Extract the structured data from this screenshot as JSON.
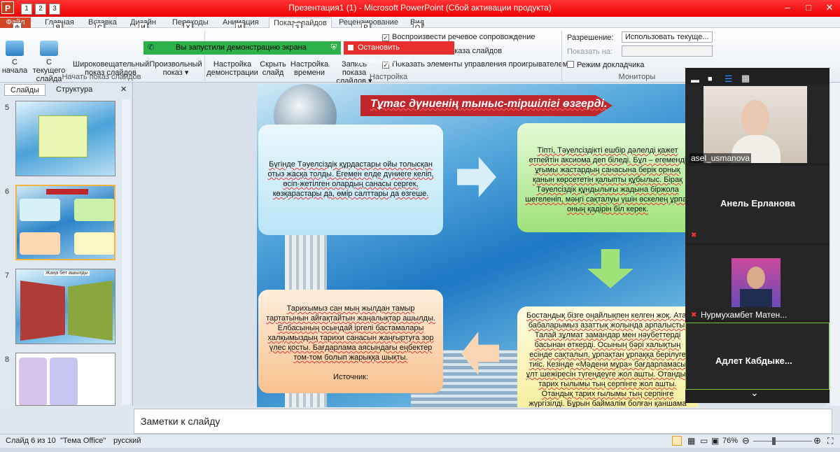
{
  "titlebar": {
    "title": "Презентация1 (1)  -  Microsoft PowerPoint (Сбой активации продукта)",
    "app_letter": "P",
    "qat_keytips": [
      "1",
      "2",
      "3"
    ],
    "minimize_label": "–",
    "restore_label": "□",
    "close_label": "✕"
  },
  "tabs": [
    {
      "label": "Файл",
      "keytip": "Ф"
    },
    {
      "label": "Главная",
      "keytip": "Я"
    },
    {
      "label": "Вставка",
      "keytip": "С"
    },
    {
      "label": "Дизайн",
      "keytip": "И"
    },
    {
      "label": "Переходы",
      "keytip": "Х"
    },
    {
      "label": "Анимация",
      "keytip": "И"
    },
    {
      "label": "Показ слайдов",
      "keytip": "З"
    },
    {
      "label": "Рецензирование",
      "keytip": "Р"
    },
    {
      "label": "Вид",
      "keytip": "О"
    }
  ],
  "ribbon": {
    "btn_from_start": "С\nначала",
    "btn_from_current": "С текущего\nслайда",
    "btn_broadcast": "Широковещательный\nпоказ слайдов",
    "btn_custom": "Произвольный\nпоказ ▾",
    "group_start": "Начать показ слайдов",
    "btn_setup": "Настройка\nдемонстрации",
    "btn_hide": "Скрыть\nслайд",
    "btn_rehearse": "Настройка\nвремени",
    "btn_record": "Запись показа\nслайдов ▾",
    "chk_narration": "Воспроизвести речевое сопровождение",
    "chk_timings": "ия показа слайдов",
    "chk_controls": "Показать элементы управления проигрывателем",
    "group_setup": "Настройка",
    "resolution_label": "Разрешение:",
    "resolution_value": "Использовать текуще...",
    "show_on_label": "Показать на:",
    "show_on_value": "",
    "presenter_view": "Режим докладчика",
    "group_monitors": "Мониторы"
  },
  "demo_bar": {
    "status": "Вы запустили демонстрацию экрана",
    "stop": "Остановить демонстрацию"
  },
  "left_pane": {
    "tab_slides": "Слайды",
    "tab_outline": "Структура",
    "close": "✕",
    "slides": [
      {
        "num": "5",
        "selected": false
      },
      {
        "num": "6",
        "selected": true
      },
      {
        "num": "7",
        "selected": false,
        "title": "Жаңа бет ашылды"
      },
      {
        "num": "8",
        "selected": false
      }
    ]
  },
  "slide": {
    "title": "Тұтас дүниенің тыныс-тіршілігі өзгерді.",
    "box1": "Бүгінде Тәуелсіздік құрдастары ойы толысқан отыз жасқа толды. Егемен елде дүниеге келіп, өсіп-жетілген олардың санасы сергек, көзқарастары да, өмір салттары да өзгеше.",
    "box2": "Тіпті, Тәуелсіздікті ешбір дәлелді қажет етпейтін аксиома деп біледі. Бұл – егеменді ұғымы жастардың санасына берік орнық қанын көрсететін қалыпты құбылыс. Бірақ Тәуелсіздік құндылығы жадына біржола шегеленіп, мәңгі сақталуы үшін өскелең ұрпақ оның қадірін біл керек.",
    "box3": "Тарихымыз сан мың жылдан тамыр тартатынын айғақтайтын жаңалықтар ашылды. Елбасының осындай іргелі бастамалары халқымыздың тарихи санасын жаңғыртуға зор үлес қосты. Бағдарлама аясындағы еңбектер том-том болып жарыққа шықты.",
    "box3_source": "Источник:",
    "box4": "Бостандық бізге оңайлықпен келген жоқ. Ата-бабаларымыз азаттық жолында арпалысты. Талай зұлмат замандар мен нәубеттерді басынан өткерді. Осының бәрі халықтың есінде сақталып, ұрпақтан ұрпаққа берілуге тиіс. Кезінде «Мәдени мұра» бағдарламасы ұлт шежіресін түгендеуге жол ашты. Отандық тарих ғылымы тың серпінге жол ашты. Отандық тарих ғылымы тың серпінге жүргізілді. Бұрын баймалім болған қаншама тарихи деректер, археологиялық қазыналар табылды."
  },
  "notes": {
    "placeholder": "Заметки к слайду"
  },
  "status": {
    "slide_info": "Слайд 6 из 10",
    "theme": "\"Тема Office\"",
    "language": "русский",
    "zoom": "76%"
  },
  "zoom_panel": {
    "participants": [
      {
        "name": "asel_usmanova",
        "muted": false,
        "video": true
      },
      {
        "name": "Анель Ерланова",
        "muted": true,
        "video": false
      },
      {
        "name": "Нурмухамбет Матен...",
        "muted": true,
        "video": true
      },
      {
        "name": "Адлет  Кабдыке...",
        "muted": false,
        "video": false
      }
    ],
    "more": "⌄"
  },
  "colors": {
    "title_red": "#e00000",
    "file_tab": "#d24726",
    "demo_green": "#2db24a",
    "demo_red": "#e92e2e",
    "slide_title_bg": "#c0272d"
  }
}
